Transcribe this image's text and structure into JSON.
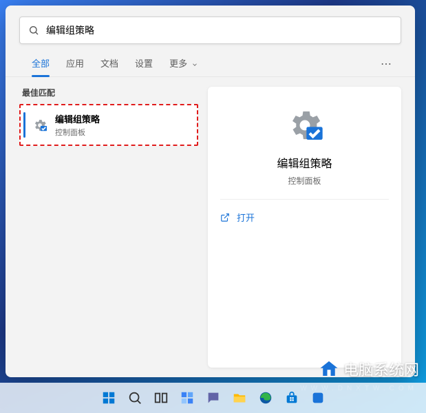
{
  "search": {
    "value": "编辑组策略"
  },
  "tabs": {
    "items": [
      {
        "label": "全部",
        "active": true
      },
      {
        "label": "应用",
        "active": false
      },
      {
        "label": "文档",
        "active": false
      },
      {
        "label": "设置",
        "active": false
      },
      {
        "label": "更多",
        "active": false
      }
    ]
  },
  "results": {
    "section_label": "最佳匹配",
    "items": [
      {
        "title": "编辑组策略",
        "subtitle": "控制面板"
      }
    ]
  },
  "detail": {
    "title": "编辑组策略",
    "subtitle": "控制面板",
    "actions": {
      "open": "打开"
    }
  },
  "branding": {
    "name": "电脑系统网",
    "domain": "WWW.DNXTW.COM"
  }
}
